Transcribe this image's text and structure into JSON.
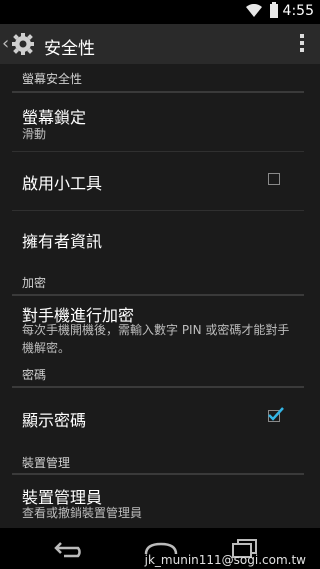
{
  "status_bar": {
    "time": "4:55"
  },
  "action_bar": {
    "title": "安全性"
  },
  "sections": {
    "screen_security": {
      "header": "螢幕安全性",
      "screen_lock": {
        "title": "螢幕鎖定",
        "summary": "滑動"
      },
      "enable_widgets": {
        "title": "啟用小工具",
        "checked": false
      },
      "owner_info": {
        "title": "擁有者資訊"
      }
    },
    "encryption": {
      "header": "加密",
      "encrypt_phone": {
        "title": "對手機進行加密",
        "summary": "每次手機開機後，需輸入數字 PIN 或密碼才能對手機解密。"
      }
    },
    "passwords": {
      "header": "密碼",
      "show_passwords": {
        "title": "顯示密碼",
        "checked": true
      }
    },
    "device_admin": {
      "header": "裝置管理",
      "device_admins": {
        "title": "裝置管理員",
        "summary": "查看或撤銷裝置管理員"
      }
    }
  },
  "watermark": "jk_munin111@sogi.com.tw",
  "colors": {
    "accent": "#33b5e5",
    "background": "#1b1b1b",
    "action_bar": "#2a2a2a"
  }
}
